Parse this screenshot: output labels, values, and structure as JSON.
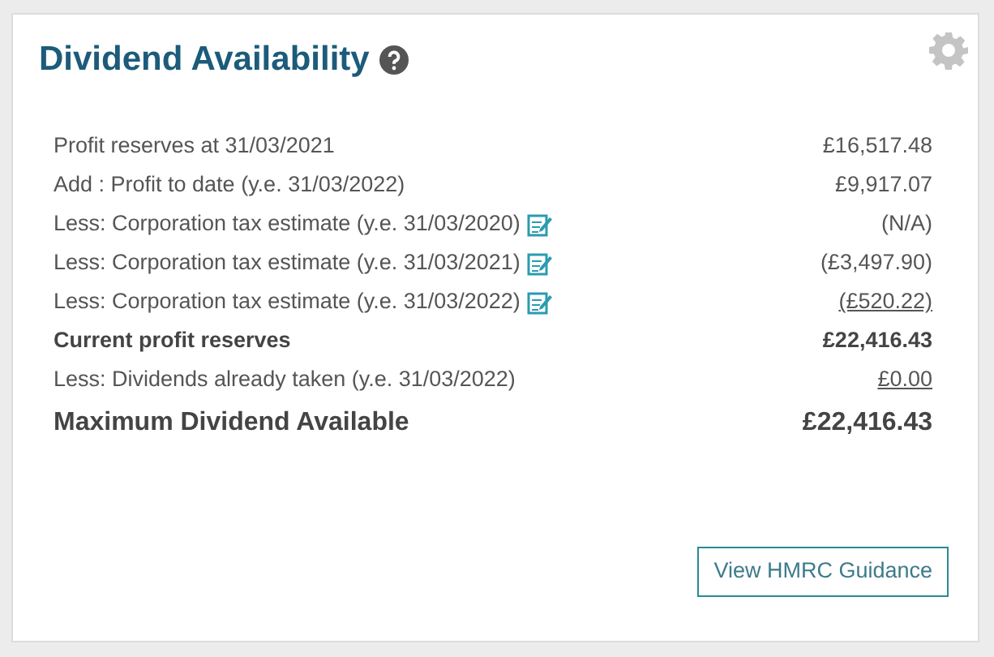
{
  "card": {
    "title": "Dividend Availability"
  },
  "rows": [
    {
      "kind": "normal",
      "label": "Profit reserves at 31/03/2021",
      "value": "£16,517.48",
      "underlined": false
    },
    {
      "kind": "normal",
      "label": "Add : Profit to date (y.e. 31/03/2022)",
      "value": "£9,917.07",
      "underlined": false
    },
    {
      "kind": "editable",
      "label": "Less: Corporation tax estimate (y.e. 31/03/2020)",
      "value": "(N/A)",
      "underlined": false
    },
    {
      "kind": "editable",
      "label": "Less: Corporation tax estimate (y.e. 31/03/2021)",
      "value": "(£3,497.90)",
      "underlined": false
    },
    {
      "kind": "editable",
      "label": "Less: Corporation tax estimate (y.e. 31/03/2022)",
      "value": "(£520.22)",
      "underlined": true
    },
    {
      "kind": "subtotal",
      "label": "Current profit reserves",
      "value": "£22,416.43",
      "underlined": false
    },
    {
      "kind": "normal",
      "label": "Less: Dividends already taken (y.e. 31/03/2022)",
      "value": "£0.00",
      "underlined": true
    },
    {
      "kind": "total",
      "label": "Maximum Dividend Available",
      "value": "£22,416.43",
      "underlined": false
    }
  ],
  "button": {
    "label": "View HMRC Guidance"
  }
}
